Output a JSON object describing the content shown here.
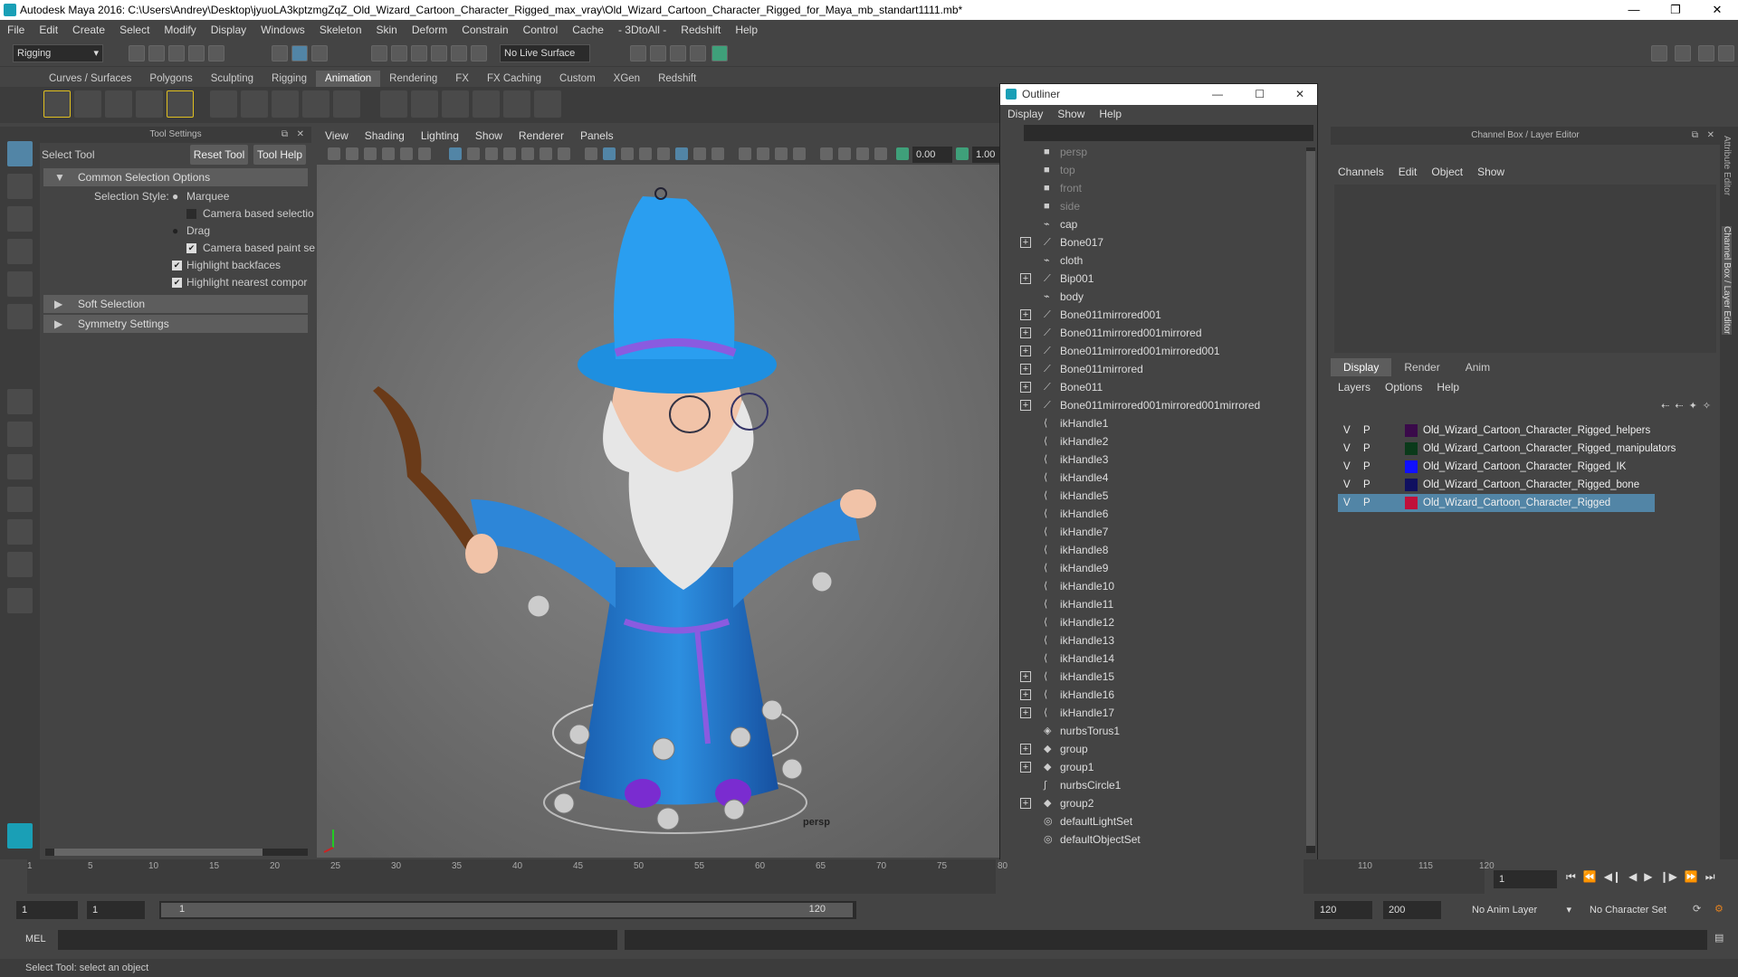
{
  "window": {
    "title": "Autodesk Maya 2016: C:\\Users\\Andrey\\Desktop\\jyuoLA3kptzmgZqZ_Old_Wizard_Cartoon_Character_Rigged_max_vray\\Old_Wizard_Cartoon_Character_Rigged_for_Maya_mb_standart1111.mb*",
    "min": "—",
    "max": "❐",
    "close": "✕"
  },
  "menubar": [
    "File",
    "Edit",
    "Create",
    "Select",
    "Modify",
    "Display",
    "Windows",
    "Skeleton",
    "Skin",
    "Deform",
    "Constrain",
    "Control",
    "Cache",
    "- 3DtoAll -",
    "Redshift",
    "Help"
  ],
  "toolbar": {
    "mode": "Rigging",
    "live_surface": "No Live Surface"
  },
  "shelf": {
    "tabs": [
      "Curves / Surfaces",
      "Polygons",
      "Sculpting",
      "Rigging",
      "Animation",
      "Rendering",
      "FX",
      "FX Caching",
      "Custom",
      "XGen",
      "Redshift"
    ],
    "active": "Animation"
  },
  "tool_settings": {
    "header": "Tool Settings",
    "tool_name": "Select Tool",
    "reset_label": "Reset Tool",
    "help_label": "Tool Help",
    "common_section": "Common Selection Options",
    "selection_style_label": "Selection Style:",
    "marquee": "Marquee",
    "camera_based_selection": "Camera based selectio",
    "drag": "Drag",
    "camera_based_paint": "Camera based paint se",
    "highlight_backfaces": "Highlight backfaces",
    "highlight_nearest": "Highlight nearest compor",
    "soft_selection": "Soft Selection",
    "symmetry_settings": "Symmetry Settings"
  },
  "viewport": {
    "menus": [
      "View",
      "Shading",
      "Lighting",
      "Show",
      "Renderer",
      "Panels"
    ],
    "field_a": "0.00",
    "field_b": "1.00",
    "camera_label": "persp"
  },
  "outliner": {
    "title": "Outliner",
    "menus": [
      "Display",
      "Show",
      "Help"
    ],
    "items": [
      {
        "name": "persp",
        "icon": "camera-icon",
        "expand": false,
        "dim": true
      },
      {
        "name": "top",
        "icon": "camera-icon",
        "expand": false,
        "dim": true
      },
      {
        "name": "front",
        "icon": "camera-icon",
        "expand": false,
        "dim": true
      },
      {
        "name": "side",
        "icon": "camera-icon",
        "expand": false,
        "dim": true
      },
      {
        "name": "cap",
        "icon": "mesh-icon",
        "expand": false,
        "dim": false
      },
      {
        "name": "Bone017",
        "icon": "joint-icon",
        "expand": true,
        "dim": false
      },
      {
        "name": "cloth",
        "icon": "mesh-icon",
        "expand": false,
        "dim": false
      },
      {
        "name": "Bip001",
        "icon": "joint-icon",
        "expand": true,
        "dim": false
      },
      {
        "name": "body",
        "icon": "mesh-icon",
        "expand": false,
        "dim": false
      },
      {
        "name": "Bone011mirrored001",
        "icon": "joint-icon",
        "expand": true,
        "dim": false
      },
      {
        "name": "Bone011mirrored001mirrored",
        "icon": "joint-icon",
        "expand": true,
        "dim": false
      },
      {
        "name": "Bone011mirrored001mirrored001",
        "icon": "joint-icon",
        "expand": true,
        "dim": false
      },
      {
        "name": "Bone011mirrored",
        "icon": "joint-icon",
        "expand": true,
        "dim": false
      },
      {
        "name": "Bone011",
        "icon": "joint-icon",
        "expand": true,
        "dim": false
      },
      {
        "name": "Bone011mirrored001mirrored001mirrored",
        "icon": "joint-icon",
        "expand": true,
        "dim": false
      },
      {
        "name": "ikHandle1",
        "icon": "ikhandle-icon",
        "expand": false,
        "dim": false
      },
      {
        "name": "ikHandle2",
        "icon": "ikhandle-icon",
        "expand": false,
        "dim": false
      },
      {
        "name": "ikHandle3",
        "icon": "ikhandle-icon",
        "expand": false,
        "dim": false
      },
      {
        "name": "ikHandle4",
        "icon": "ikhandle-icon",
        "expand": false,
        "dim": false
      },
      {
        "name": "ikHandle5",
        "icon": "ikhandle-icon",
        "expand": false,
        "dim": false
      },
      {
        "name": "ikHandle6",
        "icon": "ikhandle-icon",
        "expand": false,
        "dim": false
      },
      {
        "name": "ikHandle7",
        "icon": "ikhandle-icon",
        "expand": false,
        "dim": false
      },
      {
        "name": "ikHandle8",
        "icon": "ikhandle-icon",
        "expand": false,
        "dim": false
      },
      {
        "name": "ikHandle9",
        "icon": "ikhandle-icon",
        "expand": false,
        "dim": false
      },
      {
        "name": "ikHandle10",
        "icon": "ikhandle-icon",
        "expand": false,
        "dim": false
      },
      {
        "name": "ikHandle11",
        "icon": "ikhandle-icon",
        "expand": false,
        "dim": false
      },
      {
        "name": "ikHandle12",
        "icon": "ikhandle-icon",
        "expand": false,
        "dim": false
      },
      {
        "name": "ikHandle13",
        "icon": "ikhandle-icon",
        "expand": false,
        "dim": false
      },
      {
        "name": "ikHandle14",
        "icon": "ikhandle-icon",
        "expand": false,
        "dim": false
      },
      {
        "name": "ikHandle15",
        "icon": "ikhandle-icon",
        "expand": true,
        "dim": false
      },
      {
        "name": "ikHandle16",
        "icon": "ikhandle-icon",
        "expand": true,
        "dim": false
      },
      {
        "name": "ikHandle17",
        "icon": "ikhandle-icon",
        "expand": true,
        "dim": false
      },
      {
        "name": "nurbsTorus1",
        "icon": "nurbs-icon",
        "expand": false,
        "dim": false
      },
      {
        "name": "group",
        "icon": "group-icon",
        "expand": true,
        "dim": false
      },
      {
        "name": "group1",
        "icon": "group-icon",
        "expand": true,
        "dim": false
      },
      {
        "name": "nurbsCircle1",
        "icon": "curve-icon",
        "expand": false,
        "dim": false
      },
      {
        "name": "group2",
        "icon": "group-icon",
        "expand": true,
        "dim": false
      },
      {
        "name": "defaultLightSet",
        "icon": "set-icon",
        "expand": false,
        "dim": false
      },
      {
        "name": "defaultObjectSet",
        "icon": "set-icon",
        "expand": false,
        "dim": false
      }
    ]
  },
  "channel_box": {
    "header": "Channel Box / Layer Editor",
    "menus": [
      "Channels",
      "Edit",
      "Object",
      "Show"
    ],
    "tabs": [
      "Display",
      "Render",
      "Anim"
    ],
    "active_tab": "Display",
    "layer_menus": [
      "Layers",
      "Options",
      "Help"
    ],
    "layers": [
      {
        "v": "V",
        "p": "P",
        "color": "#3a0a4a",
        "name": "Old_Wizard_Cartoon_Character_Rigged_helpers",
        "selected": false
      },
      {
        "v": "V",
        "p": "P",
        "color": "#0a3a1a",
        "name": "Old_Wizard_Cartoon_Character_Rigged_manipulators",
        "selected": false
      },
      {
        "v": "V",
        "p": "P",
        "color": "#1010ff",
        "name": "Old_Wizard_Cartoon_Character_Rigged_IK",
        "selected": false
      },
      {
        "v": "V",
        "p": "P",
        "color": "#101060",
        "name": "Old_Wizard_Cartoon_Character_Rigged_bone",
        "selected": false
      },
      {
        "v": "V",
        "p": "P",
        "color": "#c0103a",
        "name": "Old_Wizard_Cartoon_Character_Rigged",
        "selected": true
      }
    ],
    "side_tabs": [
      "Attribute Editor",
      "Channel Box / Layer Editor"
    ]
  },
  "timeline": {
    "ticks_left": [
      "1",
      "5",
      "10",
      "15",
      "20",
      "25",
      "30",
      "35",
      "40",
      "45",
      "50",
      "55",
      "60",
      "65",
      "70",
      "75",
      "80"
    ],
    "ticks_right": [
      "110",
      "115",
      "120"
    ],
    "current_frame": "1"
  },
  "range": {
    "start": "1",
    "anim_start": "1",
    "slider_start": "1",
    "slider_end": "120",
    "end": "120",
    "anim_end": "200",
    "anim_layer": "No Anim Layer",
    "character_set": "No Character Set"
  },
  "command": {
    "label": "MEL"
  },
  "status": {
    "text": "Select Tool: select an object"
  }
}
